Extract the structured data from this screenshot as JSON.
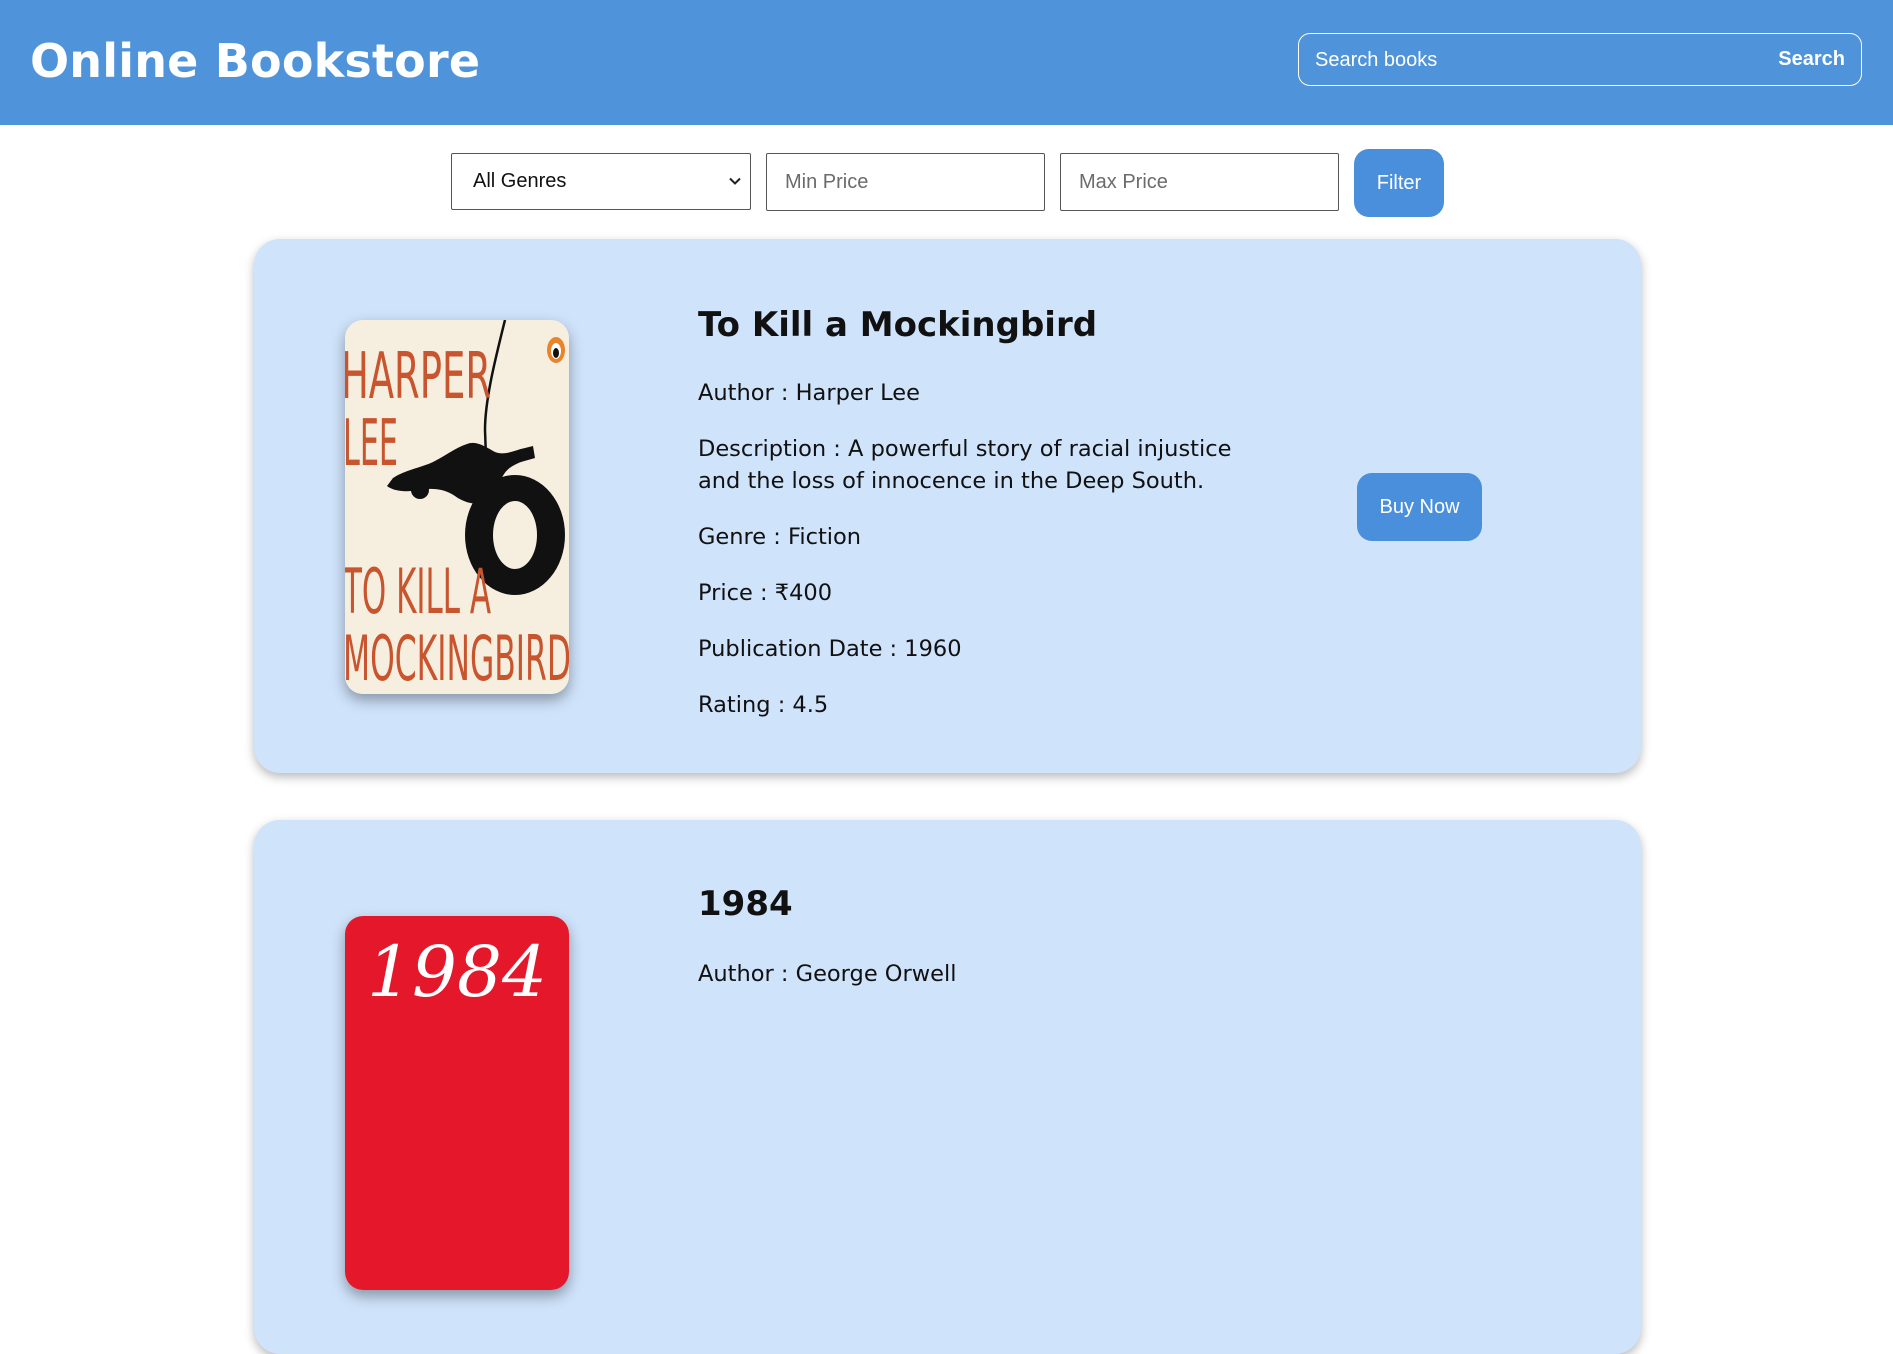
{
  "header": {
    "title": "Online Bookstore",
    "search_placeholder": "Search books",
    "search_button": "Search"
  },
  "filters": {
    "genre_selected": "All Genres",
    "min_price_placeholder": "Min Price",
    "max_price_placeholder": "Max Price",
    "filter_button": "Filter"
  },
  "books": [
    {
      "title": "To Kill a Mockingbird",
      "author": "Author : Harper Lee",
      "description": "Description : A powerful story of racial injustice and the loss of innocence in the Deep South.",
      "genre": "Genre : Fiction",
      "price": "Price : ₹400",
      "publication": "Publication Date : 1960",
      "rating": "Rating : 4.5",
      "buy_button": "Buy Now",
      "cover": {
        "line1": "HARPER",
        "line2": "LEE",
        "line3": "TO KILL A",
        "line4": "MOCKINGBIRD",
        "text_color": "#c8552e",
        "bg_color": "#f6efe0"
      }
    },
    {
      "title": "1984",
      "author": "Author : George Orwell",
      "cover": {
        "text": "1984",
        "bg_color": "#e5172a"
      }
    }
  ],
  "colors": {
    "header_bg": "#4f93da",
    "card_bg": "#cfe3fb",
    "button_bg": "#4a8fdb"
  }
}
